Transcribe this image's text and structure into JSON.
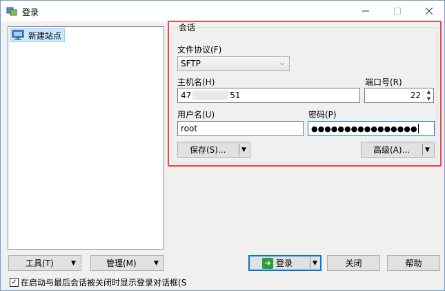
{
  "window": {
    "title": "登录"
  },
  "tree": {
    "items": [
      {
        "label": "新建站点"
      }
    ]
  },
  "session": {
    "group_title": "会话",
    "protocol_label": "文件协议(F)",
    "protocol_value": "SFTP",
    "host_label": "主机名(H)",
    "host_value_prefix": "47",
    "host_value_suffix": "51",
    "port_label": "端口号(R)",
    "port_value": "22",
    "user_label": "用户名(U)",
    "user_value": "root",
    "password_label": "密码(P)",
    "password_value": "●●●●●●●●●●●●●●●●",
    "save_label": "保存(S)...",
    "advanced_label": "高级(A)..."
  },
  "bottom": {
    "tools_label": "工具(T)",
    "manage_label": "管理(M)",
    "login_label": "登录",
    "close_label": "关闭",
    "help_label": "帮助",
    "checkbox_label": "在启动与最后会话被关闭时显示登录对话框(S",
    "checkbox_checked": true
  },
  "colors": {
    "highlight_frame": "#e8474a",
    "accent": "#0078d7"
  }
}
